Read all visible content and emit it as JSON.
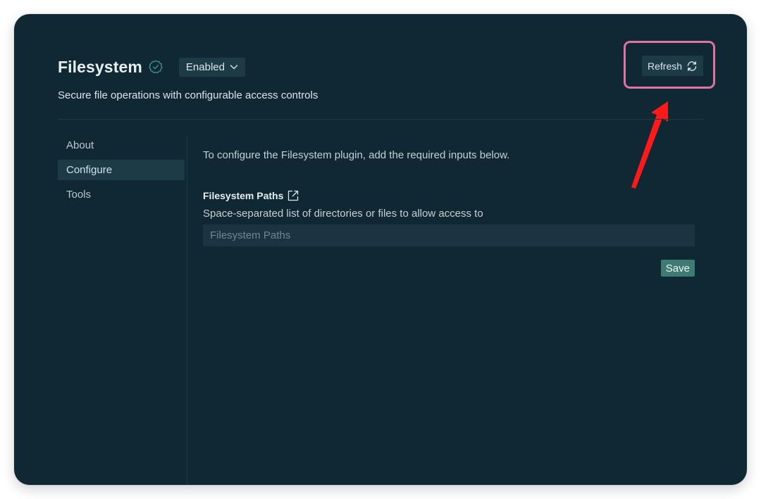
{
  "header": {
    "title": "Filesystem",
    "verified_icon": "verified-badge-icon",
    "status_dropdown": {
      "selected": "Enabled",
      "icon": "chevron-down-icon"
    },
    "subtitle": "Secure file operations with configurable access controls",
    "refresh_label": "Refresh",
    "refresh_icon": "refresh-icon"
  },
  "sidebar": {
    "items": [
      {
        "label": "About",
        "active": false
      },
      {
        "label": "Configure",
        "active": true
      },
      {
        "label": "Tools",
        "active": false
      }
    ]
  },
  "configure": {
    "intro": "To configure the Filesystem plugin, add the required inputs below.",
    "fields": [
      {
        "label": "Filesystem Paths",
        "link_icon": "external-link-icon",
        "description": "Space-separated list of directories or files to allow access to",
        "placeholder": "Filesystem Paths",
        "value": ""
      }
    ],
    "save_label": "Save"
  },
  "annotations": {
    "highlight_color": "#e0739f",
    "arrow_color": "#ff1a1a"
  },
  "colors": {
    "window_bg": "#0f2833",
    "control_bg": "#1c3b47",
    "accent_green": "#3d7b73"
  }
}
